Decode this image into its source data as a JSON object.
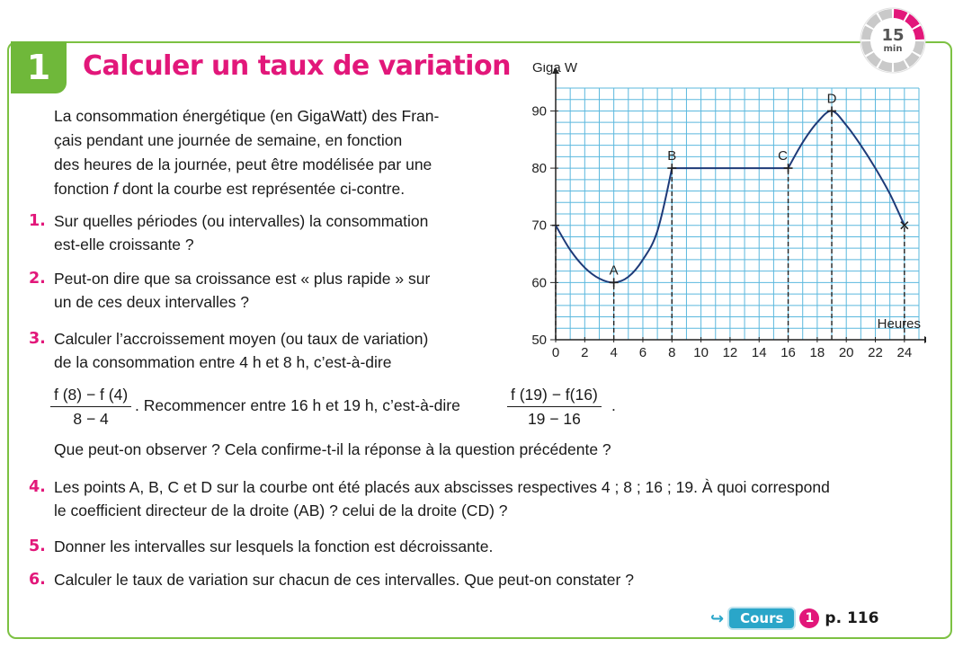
{
  "exercise": {
    "number": "1",
    "title": "Calculer un taux de variation",
    "timer": {
      "value": "15",
      "unit": "min"
    }
  },
  "intro": {
    "p1": "La consommation énergétique (en GigaWatt) des Fran-",
    "p2": "çais pendant une journée de semaine, en fonction",
    "p3": "des heures de la journée, peut être modélisée par une",
    "p4a": "fonction ",
    "p4f": "f",
    "p4b": " dont la courbe est représentée ci-contre."
  },
  "questions": [
    {
      "num": "1.",
      "lines": [
        "Sur quelles périodes (ou intervalles) la consommation",
        "est-elle croissante ?"
      ]
    },
    {
      "num": "2.",
      "lines": [
        "Peut-on dire que sa croissance est « plus rapide » sur",
        "un de ces deux intervalles ?"
      ]
    },
    {
      "num": "3.",
      "lines": [
        "Calculer l’accroissement moyen (ou taux de variation)",
        "de la consommation entre 4 h et 8 h, c’est-à-dire"
      ],
      "frac1": {
        "num": "f (8) − f (4)",
        "den": "8 − 4"
      },
      "mid": ". Recommencer entre 16 h et 19 h, c’est-à-dire",
      "frac2": {
        "num": "f (19) − f(16)",
        "den": "19 − 16"
      },
      "end": ".",
      "last": "Que peut-on observer ? Cela confirme-t-il la réponse à la question précédente ?"
    },
    {
      "num": "4.",
      "lines": [
        "Les points A, B, C et D sur la courbe ont été placés aux abscisses respectives 4 ; 8 ; 16 ; 19. À quoi correspond",
        "le coefficient directeur de la droite (AB) ? celui de la droite (CD) ?"
      ]
    },
    {
      "num": "5.",
      "lines": [
        "Donner les intervalles sur lesquels la fonction est décroissante."
      ]
    },
    {
      "num": "6.",
      "lines": [
        "Calculer le taux de variation sur chacun de ces intervalles. Que peut-on constater ?"
      ]
    }
  ],
  "reference": {
    "arrow": "↪",
    "label": "Cours",
    "num": "1",
    "page": "p. 116"
  },
  "chart_data": {
    "type": "line",
    "ylabel": "Giga W",
    "xlabel": "Heures",
    "x_ticks": [
      0,
      2,
      4,
      6,
      8,
      10,
      12,
      14,
      16,
      18,
      20,
      22,
      24
    ],
    "y_ticks": [
      50,
      60,
      70,
      80,
      90
    ],
    "xlim": [
      0,
      25
    ],
    "ylim": [
      50,
      94
    ],
    "grid": true,
    "series": [
      {
        "x": [
          0,
          1,
          2,
          3,
          4,
          5,
          6,
          7,
          8,
          9,
          10,
          11,
          12,
          13,
          14,
          15,
          16,
          17,
          18,
          19,
          20,
          21,
          22,
          23,
          24
        ],
        "y": [
          70,
          65.7,
          62.6,
          60.7,
          60,
          61,
          64,
          69,
          80,
          80,
          80,
          80,
          80,
          80,
          80,
          80,
          80,
          84.5,
          88,
          90,
          87.5,
          84,
          80,
          75.5,
          70
        ]
      }
    ],
    "points": [
      {
        "label": "A",
        "x": 4,
        "y": 60
      },
      {
        "label": "B",
        "x": 8,
        "y": 80
      },
      {
        "label": "C",
        "x": 16,
        "y": 80
      },
      {
        "label": "D",
        "x": 19,
        "y": 90
      }
    ],
    "colors": {
      "grid": "#5bb8de",
      "curve": "#1e3a78"
    }
  },
  "colors": {
    "accent": "#e2177a",
    "frame": "#7cc142",
    "badge": "#6fb83a",
    "link": "#2aa6c9"
  }
}
